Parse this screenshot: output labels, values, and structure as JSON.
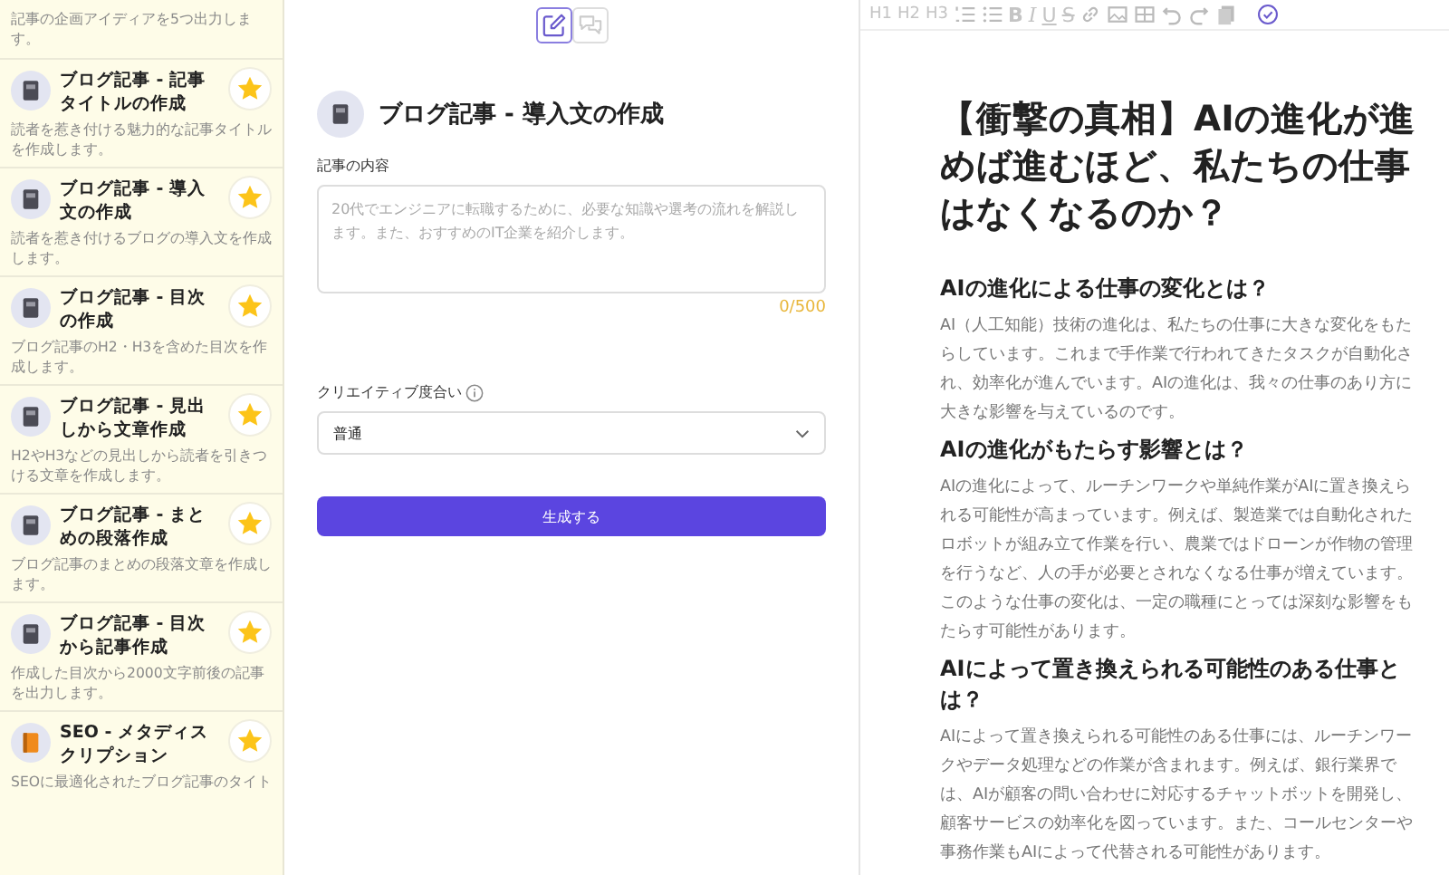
{
  "sidebar": {
    "intro_text": "記事の企画アイディアを5つ出力します。",
    "items": [
      {
        "title": "ブログ記事 - 記事タイトルの作成",
        "description": "読者を惹き付ける魅力的な記事タイトルを作成します。",
        "kind": "notebook",
        "favorite": true
      },
      {
        "title": "ブログ記事 - 導入文の作成",
        "description": "読者を惹き付けるブログの導入文を作成します。",
        "kind": "notebook",
        "favorite": true
      },
      {
        "title": "ブログ記事 - 目次の作成",
        "description": "ブログ記事のH2・H3を含めた目次を作成します。",
        "kind": "notebook",
        "favorite": true
      },
      {
        "title": "ブログ記事 - 見出しから文章作成",
        "description": "H2やH3などの見出しから読者を引きつける文章を作成します。",
        "kind": "notebook",
        "favorite": true
      },
      {
        "title": "ブログ記事 - まとめの段落作成",
        "description": "ブログ記事のまとめの段落文章を作成します。",
        "kind": "notebook",
        "favorite": true
      },
      {
        "title": "ブログ記事 - 目次から記事作成",
        "description": "作成した目次から2000文字前後の記事を出力します。",
        "kind": "notebook",
        "favorite": true
      },
      {
        "title": "SEO - メタディスクリプション",
        "description": "SEOに最適化されたブログ記事のタイト",
        "kind": "book",
        "favorite": true
      }
    ]
  },
  "mode_toggle": [
    {
      "selected": true
    },
    {
      "selected": false
    }
  ],
  "form": {
    "title": "ブログ記事 - 導入文の作成",
    "content_label": "記事の内容",
    "content_placeholder": "20代でエンジニアに転職するために、必要な知識や選考の流れを解説します。また、おすすめのIT企業を紹介します。",
    "counter": "0/500",
    "creativity_label": "クリエイティブ度合い",
    "creativity_value": "普通",
    "generate_button": "生成する"
  },
  "editor": {
    "heading_tools": [
      "H1",
      "H2",
      "H3"
    ],
    "format_tools": [
      "B",
      "I",
      "U",
      "S"
    ],
    "title": "【衝撃の真相】AIの進化が進めば進むほど、私たちの仕事はなくなるのか？",
    "sections": [
      {
        "heading": "AIの進化による仕事の変化とは？",
        "body": "AI（人工知能）技術の進化は、私たちの仕事に大きな変化をもたらしています。これまで手作業で行われてきたタスクが自動化され、効率化が進んでいます。AIの進化は、我々の仕事のあり方に大きな影響を与えているのです。"
      },
      {
        "heading": "AIの進化がもたらす影響とは？",
        "body": "AIの進化によって、ルーチンワークや単純作業がAIに置き換えられる可能性が高まっています。例えば、製造業では自動化されたロボットが組み立て作業を行い、農業ではドローンが作物の管理を行うなど、人の手が必要とされなくなる仕事が増えています。このような仕事の変化は、一定の職種にとっては深刻な影響をもたらす可能性があります。"
      },
      {
        "heading": "AIによって置き換えられる可能性のある仕事とは？",
        "body": "AIによって置き換えられる可能性のある仕事には、ルーチンワークやデータ処理などの作業が含まれます。例えば、銀行業界では、AIが顧客の問い合わせに対応するチャットボットを開発し、顧客サービスの効率化を図っています。また、コールセンターや事務作業もAIによって代替される可能性があります。"
      }
    ]
  }
}
